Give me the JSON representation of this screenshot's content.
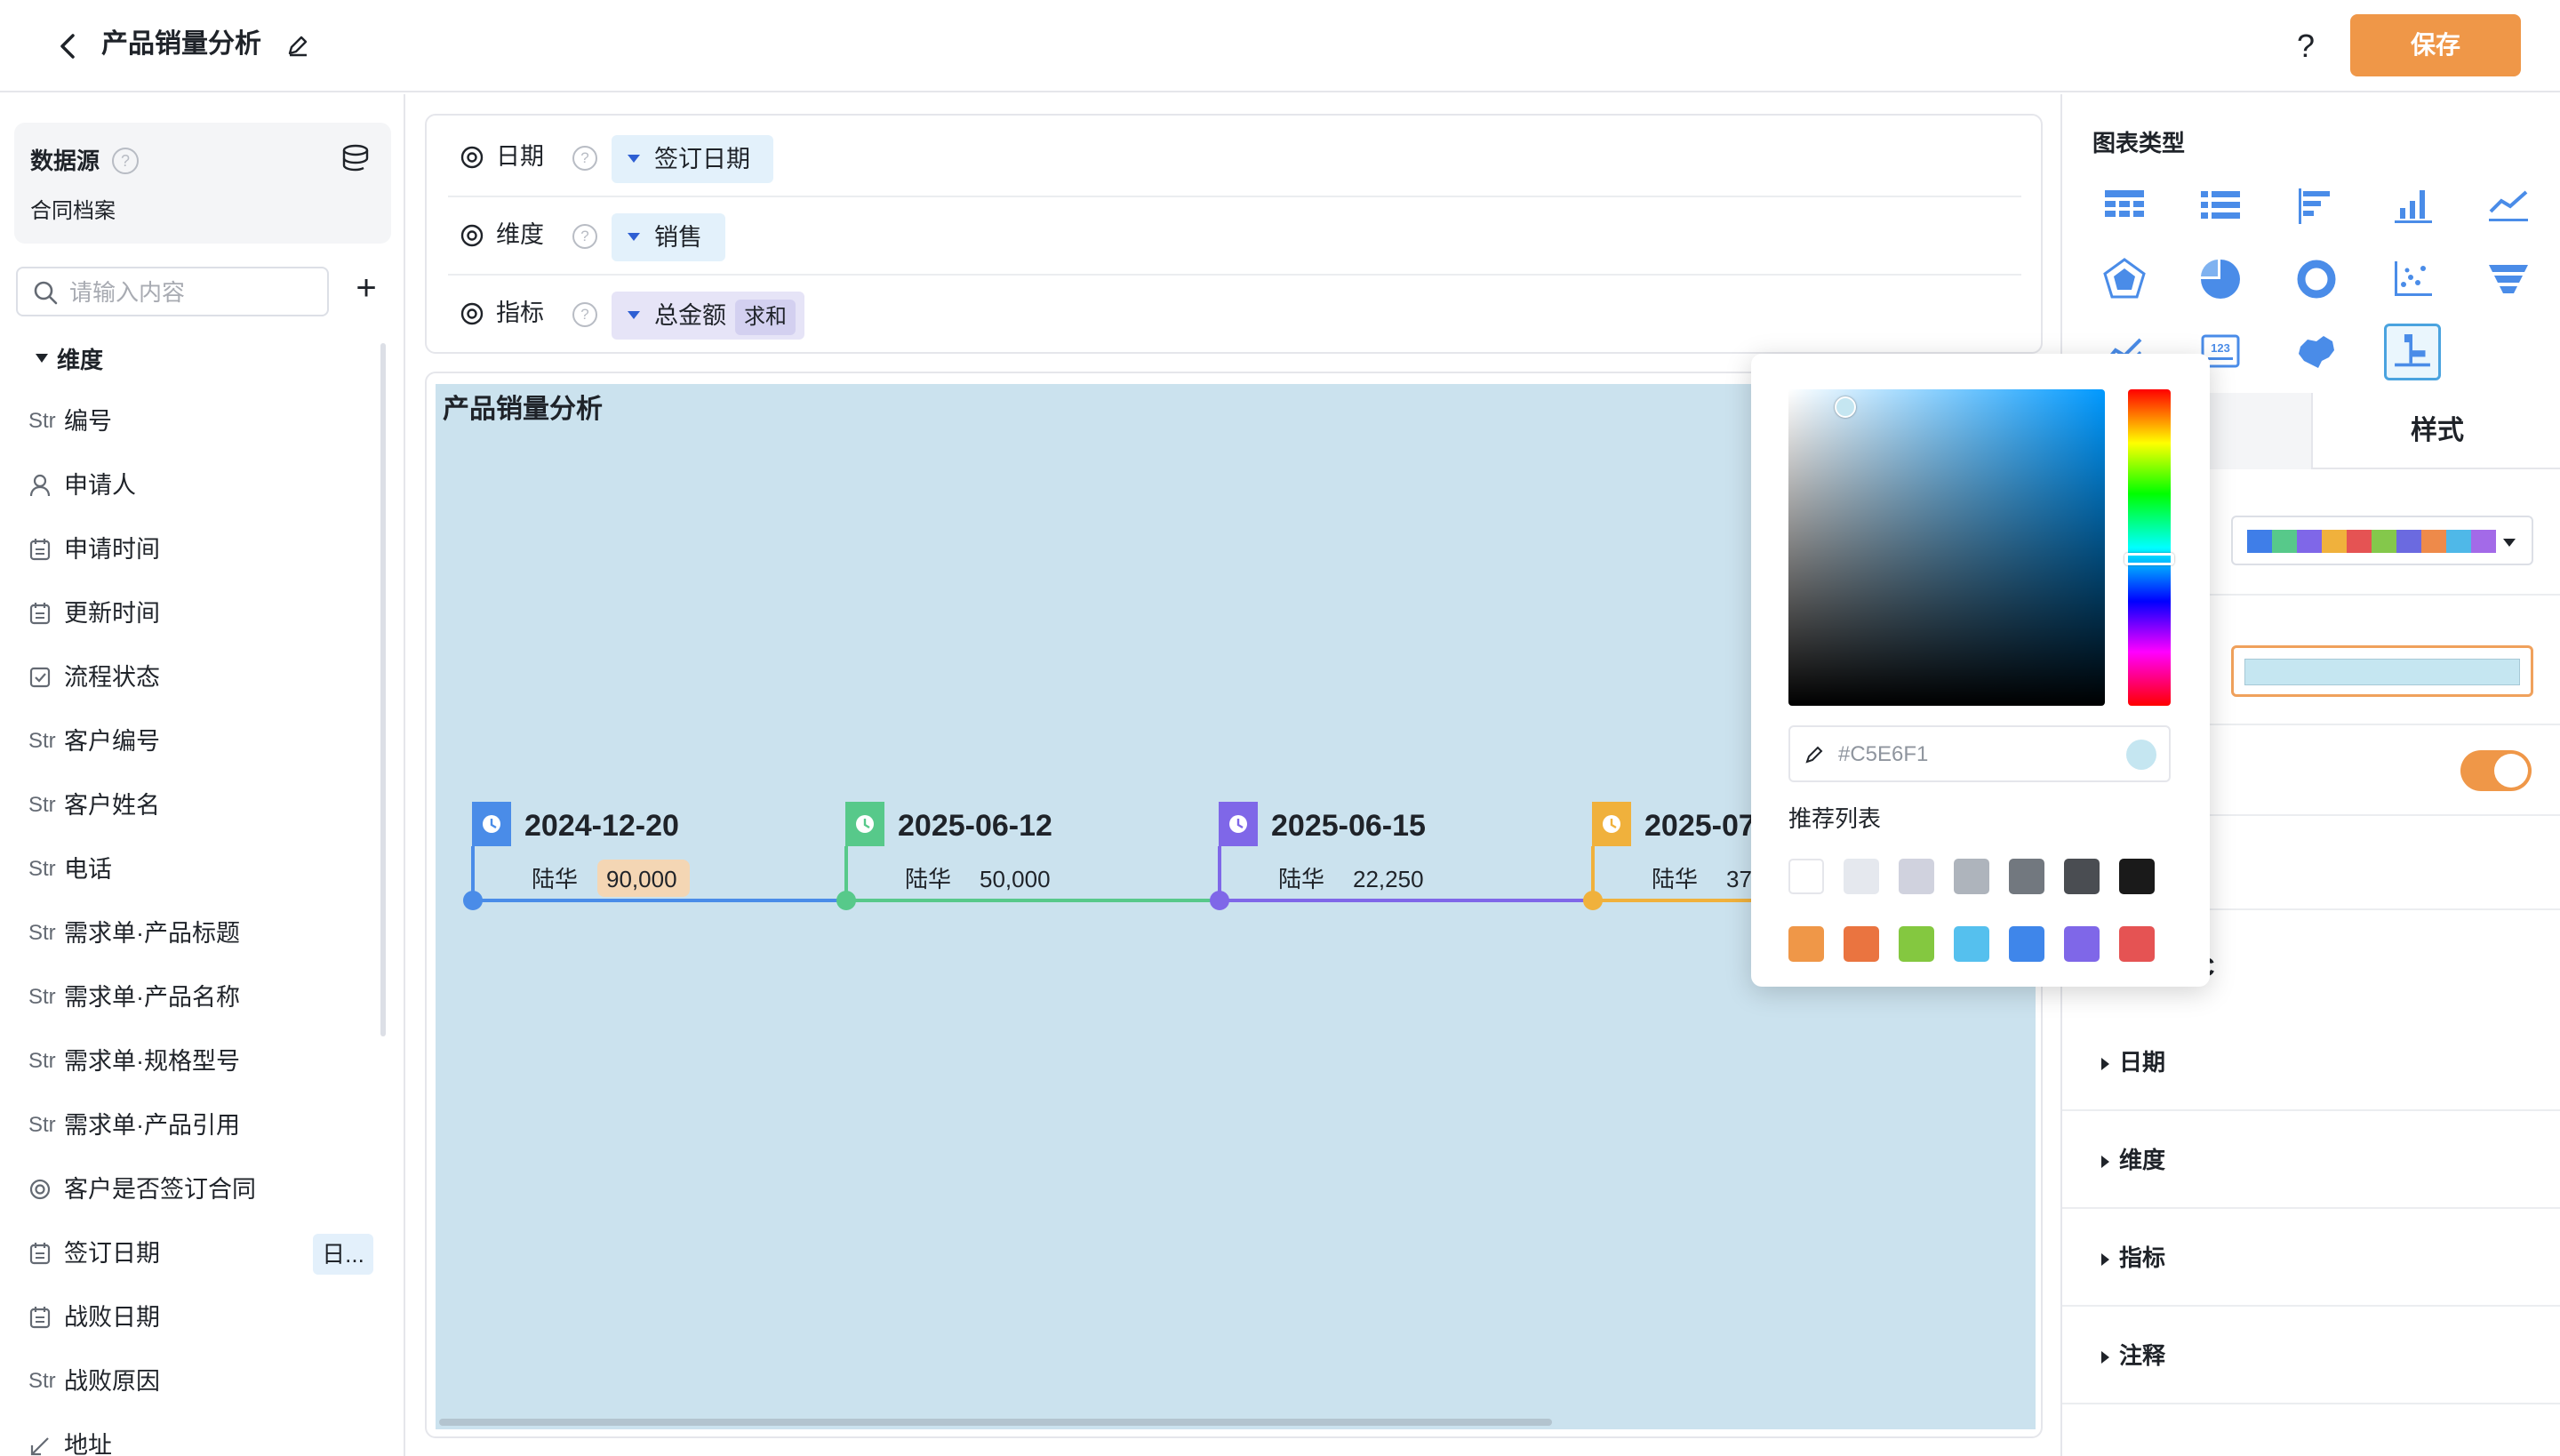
{
  "header": {
    "title": "产品销量分析",
    "help": "?",
    "save_label": "保存"
  },
  "datasource": {
    "title": "数据源",
    "name": "合同档案",
    "search_placeholder": "请输入内容",
    "group_title": "维度"
  },
  "fields": [
    {
      "label": "编号",
      "icon": "Str"
    },
    {
      "label": "申请人",
      "icon": "user-icon"
    },
    {
      "label": "申请时间",
      "icon": "calendar-icon"
    },
    {
      "label": "更新时间",
      "icon": "calendar-icon"
    },
    {
      "label": "流程状态",
      "icon": "checkbox-icon"
    },
    {
      "label": "客户编号",
      "icon": "Str"
    },
    {
      "label": "客户姓名",
      "icon": "Str"
    },
    {
      "label": "电话",
      "icon": "Str"
    },
    {
      "label": "需求单·产品标题",
      "icon": "Str"
    },
    {
      "label": "需求单·产品名称",
      "icon": "Str"
    },
    {
      "label": "需求单·规格型号",
      "icon": "Str"
    },
    {
      "label": "需求单·产品引用",
      "icon": "Str"
    },
    {
      "label": "客户是否签订合同",
      "icon": "radio-icon"
    },
    {
      "label": "签订日期",
      "icon": "calendar-icon",
      "tag": "日..."
    },
    {
      "label": "战败日期",
      "icon": "calendar-icon"
    },
    {
      "label": "战败原因",
      "icon": "Str"
    },
    {
      "label": "地址",
      "icon": "location-icon"
    }
  ],
  "config": {
    "rows": [
      {
        "label": "日期",
        "help": "?",
        "chip": "签订日期"
      },
      {
        "label": "维度",
        "help": "?",
        "chip": "销售"
      },
      {
        "label": "指标",
        "help": "?",
        "chip": "总金额",
        "agg": "求和"
      }
    ]
  },
  "chart_data": {
    "type": "timeline",
    "title": "产品销量分析",
    "events": [
      {
        "date": "2024-12-20",
        "name": "陆华",
        "value": "90,000",
        "color": "#4a8ce8",
        "highlight": true
      },
      {
        "date": "2025-06-12",
        "name": "陆华",
        "value": "50,000",
        "color": "#57c98a"
      },
      {
        "date": "2025-06-15",
        "name": "陆华",
        "value": "22,250",
        "color": "#7f67e8"
      },
      {
        "date": "2025-07",
        "name": "陆华",
        "value": "37",
        "color": "#f0b13c"
      },
      {
        "date": "",
        "name": "",
        "value": "",
        "color": "#e55353"
      }
    ],
    "background": "#cbe2ee"
  },
  "right_panel": {
    "chart_type_title": "图表类型",
    "tab_data": "",
    "tab_style": "样式",
    "partial_char": "C",
    "sections": [
      "日期",
      "维度",
      "指标",
      "注释"
    ],
    "palette": [
      "#3f7ee8",
      "#57c98a",
      "#7f67e8",
      "#f0b13c",
      "#e55353",
      "#84c84b",
      "#6b6ae0",
      "#ee8a4a",
      "#4fb8e8",
      "#a36ae8"
    ]
  },
  "color_picker": {
    "hex": "#C5E6F1",
    "recommend_title": "推荐列表",
    "row1": [
      "#ffffff",
      "#e5e8ee",
      "#d0d2de",
      "#aeb4bc",
      "#72787f",
      "#4a4d52",
      "#1a1a1a"
    ],
    "row2": [
      "#ef9748",
      "#ea7440",
      "#84c840",
      "#55c0ee",
      "#3f86ea",
      "#7f67e8",
      "#e55353"
    ]
  }
}
